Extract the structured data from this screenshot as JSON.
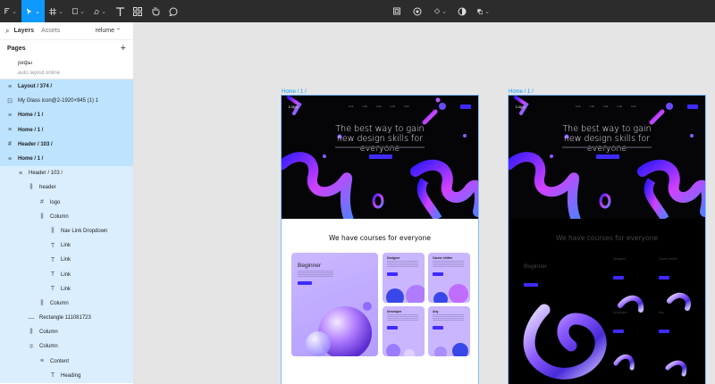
{
  "toolbar": {
    "left_icons": [
      "figma-menu-icon",
      "move-tool-icon",
      "frame-tool-icon",
      "shape-tool-icon",
      "pen-tool-icon",
      "text-tool-icon",
      "resources-icon",
      "hand-tool-icon",
      "comment-icon"
    ],
    "center_icons": [
      "crop-icon",
      "mask-icon",
      "component-icon",
      "contrast-icon",
      "boolean-icon"
    ]
  },
  "panel": {
    "tabs": {
      "layers": "Layers",
      "assets": "Assets",
      "file": "relume"
    },
    "pages_label": "Pages",
    "pages": [
      "рефы",
      "auto layout online"
    ],
    "layers": [
      {
        "icon": "≡",
        "label": "Layout / 374 /",
        "indent": 0,
        "state": "sel",
        "bold": true
      },
      {
        "icon": "⊡",
        "label": "My Glass icon@2-1920×945 (1) 1",
        "indent": 0,
        "state": "sel",
        "bold": false
      },
      {
        "icon": "≡",
        "label": "Home / 1 /",
        "indent": 0,
        "state": "sel",
        "bold": true
      },
      {
        "icon": "≡",
        "label": "Home / 1 /",
        "indent": 0,
        "state": "sel",
        "bold": true
      },
      {
        "icon": "#",
        "label": "Header / 103 /",
        "indent": 0,
        "state": "sel",
        "bold": true
      },
      {
        "icon": "≡",
        "label": "Home / 1 /",
        "indent": 0,
        "state": "sel",
        "bold": true
      },
      {
        "icon": "≡",
        "label": "Header / 103 /",
        "indent": 1,
        "state": "sel2",
        "bold": false
      },
      {
        "icon": "⫼",
        "label": "header",
        "indent": 2,
        "state": "sel2",
        "bold": false
      },
      {
        "icon": "#",
        "label": "logo",
        "indent": 3,
        "state": "sel2",
        "bold": false
      },
      {
        "icon": "⫼",
        "label": "Column",
        "indent": 3,
        "state": "sel2",
        "bold": false
      },
      {
        "icon": "⫼",
        "label": "Nav Link Dropdown",
        "indent": 4,
        "state": "sel2",
        "bold": false
      },
      {
        "icon": "T",
        "label": "Link",
        "indent": 4,
        "state": "sel2",
        "bold": false
      },
      {
        "icon": "T",
        "label": "Link",
        "indent": 4,
        "state": "sel2",
        "bold": false
      },
      {
        "icon": "T",
        "label": "Link",
        "indent": 4,
        "state": "sel2",
        "bold": false
      },
      {
        "icon": "T",
        "label": "Link",
        "indent": 4,
        "state": "sel2",
        "bold": false
      },
      {
        "icon": "⫼",
        "label": "Column",
        "indent": 3,
        "state": "sel2",
        "bold": false
      },
      {
        "icon": "—",
        "label": "Rectangle 111081723",
        "indent": 2,
        "state": "sel2",
        "bold": false
      },
      {
        "icon": "⫼",
        "label": "Column",
        "indent": 2,
        "state": "sel2",
        "bold": false
      },
      {
        "icon": "≑",
        "label": "Column",
        "indent": 2,
        "state": "sel2",
        "bold": false
      },
      {
        "icon": "≡",
        "label": "Content",
        "indent": 3,
        "state": "sel2",
        "bold": false
      },
      {
        "icon": "T",
        "label": "Heading",
        "indent": 4,
        "state": "sel2",
        "bold": false
      }
    ]
  },
  "canvas": {
    "frame1_label": "Home / 1 /",
    "frame2_label": "Home / 1 /",
    "site": {
      "logo": "Logo",
      "nav_links": [
        "Link",
        "Link",
        "Link",
        "Link",
        "Link"
      ],
      "hero_title": "The best way to gain new design skills for everyone",
      "courses_title": "We have courses for everyone",
      "cards": [
        {
          "title": "Beginner"
        },
        {
          "title": "Designer"
        },
        {
          "title": "Career shifter"
        },
        {
          "title": "Developer"
        },
        {
          "title": "Any"
        }
      ]
    }
  },
  "colors": {
    "accent": "#0d99ff",
    "brand_button": "#3f2bff",
    "selection": "#bde3ff",
    "selection_light": "#daeefe"
  }
}
